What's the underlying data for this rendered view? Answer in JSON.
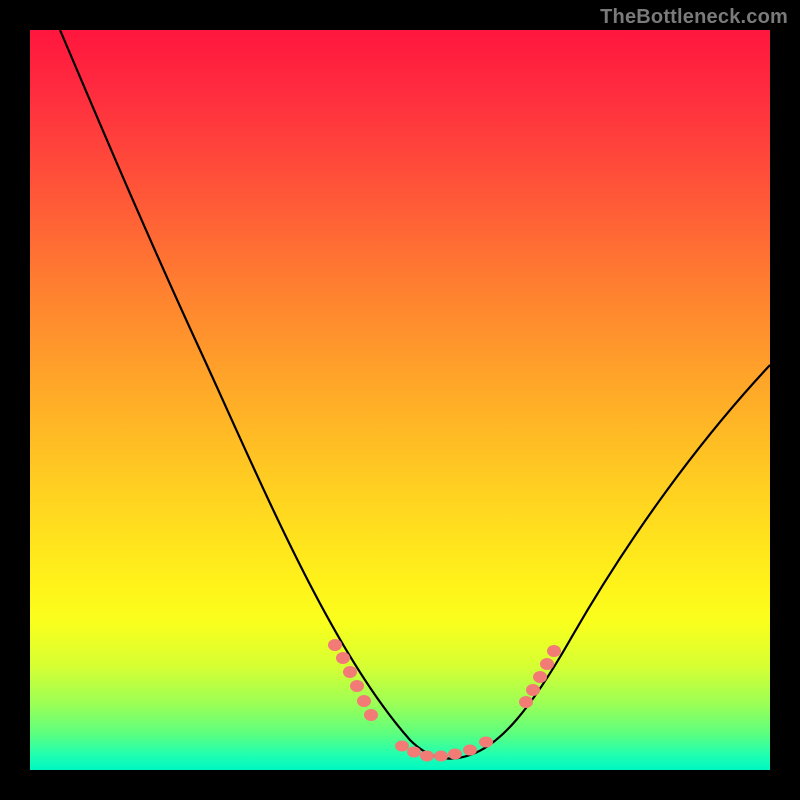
{
  "watermark": "TheBottleneck.com",
  "chart_data": {
    "type": "line",
    "title": "",
    "xlabel": "",
    "ylabel": "",
    "xlim": [
      0,
      100
    ],
    "ylim": [
      0,
      100
    ],
    "series": [
      {
        "name": "bottleneck-curve",
        "x": [
          4,
          8,
          14,
          20,
          26,
          32,
          38,
          44,
          48,
          52,
          56,
          58,
          60,
          64,
          70,
          76,
          84,
          92,
          100
        ],
        "y": [
          100,
          90,
          77,
          65,
          52,
          40,
          28,
          15,
          8,
          3,
          1.5,
          1.5,
          2,
          4,
          10,
          18,
          30,
          42,
          55
        ]
      }
    ],
    "markers": {
      "name": "highlight-dots",
      "color": "#f27b76",
      "groups": [
        {
          "label": "left-cluster",
          "x_range": [
            42,
            47
          ],
          "y_range": [
            6,
            16
          ]
        },
        {
          "label": "trough",
          "x_range": [
            51,
            62
          ],
          "y_range": [
            1,
            3
          ]
        },
        {
          "label": "right-cluster",
          "x_range": [
            67,
            71
          ],
          "y_range": [
            7,
            16
          ]
        }
      ]
    },
    "background_gradient": {
      "top": "#ff163e",
      "bottom": "#00f7c2"
    }
  }
}
